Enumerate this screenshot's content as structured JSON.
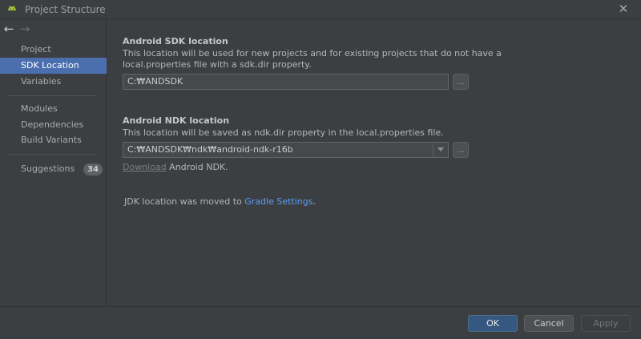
{
  "window": {
    "title": "Project Structure",
    "app_icon": "android-icon",
    "close_icon": "close-icon",
    "close_glyph": "✕"
  },
  "nav": {
    "back_glyph": "←",
    "forward_glyph": "→"
  },
  "sidebar": {
    "group1": [
      "Project",
      "SDK Location",
      "Variables"
    ],
    "group2": [
      "Modules",
      "Dependencies",
      "Build Variants"
    ],
    "suggestions": {
      "label": "Suggestions",
      "count": "34"
    },
    "selected": "SDK Location"
  },
  "sdk": {
    "title": "Android SDK location",
    "desc_line1": "This location will be used for new projects and for existing projects that do not have a",
    "desc_line2": "local.properties file with a sdk.dir property.",
    "value": "C:₩ANDSDK",
    "browse_label": "..."
  },
  "ndk": {
    "title": "Android NDK location",
    "desc": "This location will be saved as ndk.dir property in the local.properties file.",
    "value": "C:₩ANDSDK₩ndk₩android-ndk-r16b",
    "browse_label": "...",
    "download_link": "Download",
    "download_suffix": " Android NDK."
  },
  "jdk": {
    "prefix": "JDK location was moved to ",
    "link": "Gradle Settings",
    "suffix": "."
  },
  "buttons": {
    "ok": "OK",
    "cancel": "Cancel",
    "apply": "Apply"
  },
  "colors": {
    "background": "#3c3f41",
    "selection": "#4b6eaf",
    "link": "#589df6",
    "ok_button": "#365880",
    "android_green": "#a4c639"
  }
}
